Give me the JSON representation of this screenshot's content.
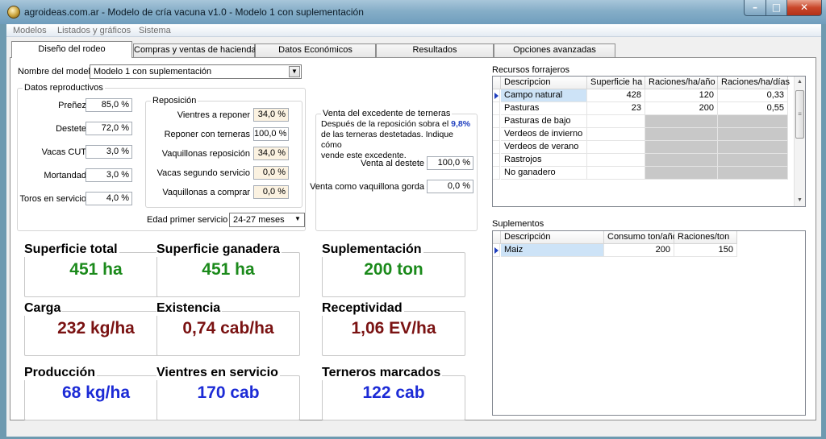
{
  "window": {
    "title": "agroideas.com.ar - Modelo de cría vacuna v1.0 - Modelo 1 con suplementación",
    "minimize": "–",
    "maximize": "□",
    "close": "✕"
  },
  "menu": [
    "Modelos",
    "Listados y gráficos",
    "Sistema"
  ],
  "tabs": [
    "Diseño del rodeo",
    "Compras y ventas de hacienda",
    "Datos Económicos",
    "Resultados",
    "Opciones avanzadas"
  ],
  "model": {
    "label": "Nombre del modelo",
    "value": "Modelo 1 con suplementación"
  },
  "reproductive": {
    "title": "Datos reproductivos",
    "fields": [
      {
        "label": "Preñez",
        "value": "85,0 %"
      },
      {
        "label": "Destete",
        "value": "72,0 %"
      },
      {
        "label": "Vacas CUT",
        "value": "3,0 %"
      },
      {
        "label": "Mortandad",
        "value": "3,0 %"
      },
      {
        "label": "Toros en servicio",
        "value": "4,0 %"
      }
    ]
  },
  "replacement": {
    "title": "Reposición",
    "fields": [
      {
        "label": "Vientres a reponer",
        "value": "34,0 %"
      },
      {
        "label": "Reponer con terneras",
        "value": "100,0 %"
      },
      {
        "label": "Vaquillonas reposición",
        "value": "34,0 %"
      },
      {
        "label": "Vacas segundo servicio",
        "value": "0,0 %"
      },
      {
        "label": "Vaquillonas a comprar",
        "value": "0,0 %"
      }
    ],
    "first_service": {
      "label": "Edad primer servicio",
      "value": "24-27 meses"
    }
  },
  "excess": {
    "title": "Venta del excedente de terneras",
    "line1": "Después de la reposición sobra el",
    "pct": "9,8%",
    "line2": "de las terneras destetadas. Indique cómo",
    "line3": "vende este excedente.",
    "fields": [
      {
        "label": "Venta al destete",
        "value": "100,0 %"
      },
      {
        "label": "Venta como vaquillona gorda",
        "value": "0,0 %"
      }
    ]
  },
  "cards": [
    {
      "title": "Superficie total",
      "value": "451 ha",
      "color": "#1b8a1b"
    },
    {
      "title": "Superficie ganadera",
      "value": "451 ha",
      "color": "#1b8a1b"
    },
    {
      "title": "Suplementación",
      "value": "200 ton",
      "color": "#1b8a1b"
    },
    {
      "title": "Carga",
      "value": "232 kg/ha",
      "color": "#7a1212"
    },
    {
      "title": "Existencia",
      "value": "0,74 cab/ha",
      "color": "#7a1212"
    },
    {
      "title": "Receptividad",
      "value": "1,06 EV/ha",
      "color": "#7a1212"
    },
    {
      "title": "Producción",
      "value": "68 kg/ha",
      "color": "#1c2bd6"
    },
    {
      "title": "Vientres en servicio",
      "value": "170 cab",
      "color": "#1c2bd6"
    },
    {
      "title": "Terneros marcados",
      "value": "122 cab",
      "color": "#1c2bd6"
    }
  ],
  "forage": {
    "title": "Recursos forrajeros",
    "columns": [
      "Descripcion",
      "Superficie ha",
      "Raciones/ha/año",
      "Raciones/ha/días"
    ],
    "rows": [
      {
        "desc": "Campo natural",
        "sup": "428",
        "rac_year": "120",
        "rac_day": "0,33"
      },
      {
        "desc": "Pasturas",
        "sup": "23",
        "rac_year": "200",
        "rac_day": "0,55"
      },
      {
        "desc": "Pasturas de bajo",
        "sup": "",
        "rac_year": "",
        "rac_day": ""
      },
      {
        "desc": "Verdeos de invierno",
        "sup": "",
        "rac_year": "",
        "rac_day": ""
      },
      {
        "desc": "Verdeos de verano",
        "sup": "",
        "rac_year": "",
        "rac_day": ""
      },
      {
        "desc": "Rastrojos",
        "sup": "",
        "rac_year": "",
        "rac_day": ""
      },
      {
        "desc": "No ganadero",
        "sup": "",
        "rac_year": "",
        "rac_day": ""
      }
    ]
  },
  "supplements": {
    "title": "Suplementos",
    "columns": [
      "Descripción",
      "Consumo ton/año",
      "Raciones/ton"
    ],
    "rows": [
      {
        "desc": "Maiz",
        "consumo": "200",
        "raciones": "150"
      }
    ]
  },
  "icons": {
    "scroll_up": "▲",
    "scroll_down": "▼",
    "combo_arrow": "▼",
    "row_pointer": "pointer-icon"
  }
}
